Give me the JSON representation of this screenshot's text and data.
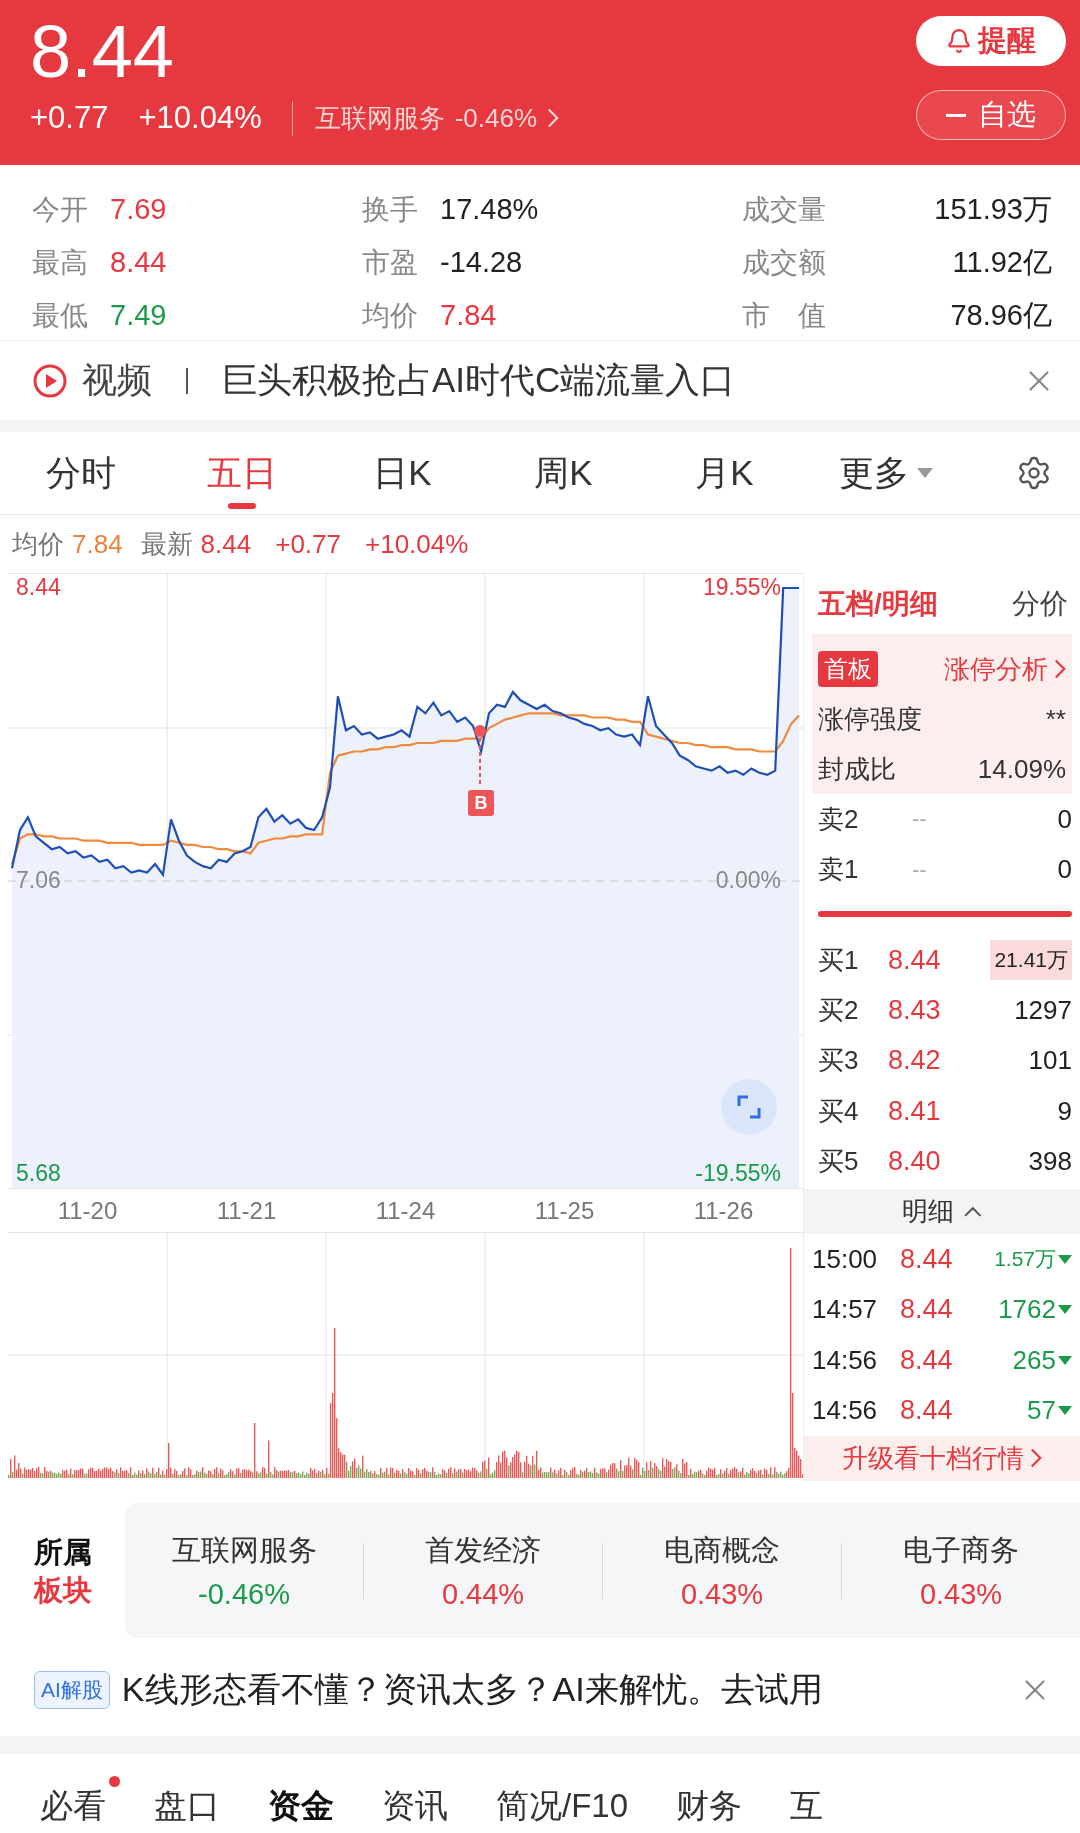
{
  "header": {
    "price": "8.44",
    "change": "+0.77",
    "change_pct": "+10.04%",
    "sector": "互联网服务",
    "sector_change": "-0.46%",
    "alert_button": "提醒",
    "watch_button": "自选"
  },
  "stats": [
    {
      "label": "今开",
      "value": "7.69",
      "color": "#e6393f"
    },
    {
      "label": "换手",
      "value": "17.48%",
      "color": "#222222"
    },
    {
      "label": "成交量",
      "value": "151.93万",
      "color": "#222222"
    },
    {
      "label": "最高",
      "value": "8.44",
      "color": "#e6393f"
    },
    {
      "label": "市盈",
      "value": "-14.28",
      "color": "#222222"
    },
    {
      "label": "成交额",
      "value": "11.92亿",
      "color": "#222222"
    },
    {
      "label": "最低",
      "value": "7.49",
      "color": "#1a9a4a"
    },
    {
      "label": "均价",
      "value": "7.84",
      "color": "#e6393f"
    },
    {
      "label": "市　值",
      "value": "78.96亿",
      "color": "#222222"
    }
  ],
  "news": {
    "tag": "视频",
    "text": "巨头积极抢占AI时代C端流量入口"
  },
  "chart_tabs": [
    {
      "label": "分时",
      "selected": false
    },
    {
      "label": "五日",
      "selected": true
    },
    {
      "label": "日K",
      "selected": false
    },
    {
      "label": "周K",
      "selected": false
    },
    {
      "label": "月K",
      "selected": false
    },
    {
      "label": "更多",
      "selected": false
    }
  ],
  "chart_info": {
    "avg": "7.84",
    "last": "8.44",
    "change": "+0.77",
    "change_pct": "+10.04%"
  },
  "chart": {
    "right_labels": [
      "19.55%",
      "0.00%",
      "-19.55%"
    ],
    "marker": "B",
    "dates": [
      "11-20",
      "11-21",
      "11-24",
      "11-25",
      "11-26"
    ],
    "chart_data": {
      "type": "line",
      "ylim": [
        5.68,
        8.44
      ],
      "yticks": [
        8.44,
        7.06,
        5.68
      ],
      "series": [
        {
          "name": "最新",
          "color": "#1f4fb5",
          "values": [
            7.12,
            7.3,
            7.36,
            7.27,
            7.24,
            7.21,
            7.22,
            7.19,
            7.2,
            7.17,
            7.18,
            7.15,
            7.16,
            7.12,
            7.13,
            7.1,
            7.11,
            7.1,
            7.14,
            7.09,
            7.35,
            7.25,
            7.18,
            7.15,
            7.13,
            7.12,
            7.16,
            7.15,
            7.19,
            7.2,
            7.22,
            7.36,
            7.4,
            7.34,
            7.37,
            7.33,
            7.35,
            7.31,
            7.3,
            7.36,
            7.5,
            7.93,
            7.77,
            7.79,
            7.75,
            7.76,
            7.73,
            7.74,
            7.75,
            7.77,
            7.74,
            7.88,
            7.85,
            7.9,
            7.84,
            7.86,
            7.81,
            7.83,
            7.79,
            7.67,
            7.85,
            7.89,
            7.88,
            7.95,
            7.91,
            7.89,
            7.87,
            7.89,
            7.86,
            7.85,
            7.83,
            7.82,
            7.8,
            7.79,
            7.77,
            7.78,
            7.75,
            7.74,
            7.75,
            7.7,
            7.93,
            7.79,
            7.75,
            7.71,
            7.65,
            7.63,
            7.6,
            7.59,
            7.58,
            7.6,
            7.57,
            7.58,
            7.56,
            7.59,
            7.57,
            7.56,
            7.58,
            8.44,
            8.44,
            8.44
          ]
        },
        {
          "name": "均价",
          "color": "#f08a3c",
          "values": [
            7.14,
            7.26,
            7.28,
            7.28,
            7.27,
            7.27,
            7.26,
            7.26,
            7.26,
            7.25,
            7.25,
            7.25,
            7.24,
            7.24,
            7.24,
            7.24,
            7.23,
            7.23,
            7.23,
            7.23,
            7.25,
            7.24,
            7.23,
            7.23,
            7.22,
            7.22,
            7.21,
            7.21,
            7.2,
            7.2,
            7.19,
            7.24,
            7.25,
            7.26,
            7.26,
            7.27,
            7.27,
            7.28,
            7.28,
            7.28,
            7.57,
            7.65,
            7.66,
            7.67,
            7.67,
            7.68,
            7.68,
            7.69,
            7.69,
            7.7,
            7.7,
            7.71,
            7.71,
            7.71,
            7.72,
            7.72,
            7.72,
            7.73,
            7.73,
            7.73,
            7.78,
            7.8,
            7.82,
            7.83,
            7.84,
            7.85,
            7.85,
            7.85,
            7.85,
            7.84,
            7.84,
            7.84,
            7.84,
            7.83,
            7.83,
            7.83,
            7.82,
            7.82,
            7.81,
            7.81,
            7.75,
            7.74,
            7.73,
            7.72,
            7.71,
            7.71,
            7.7,
            7.7,
            7.69,
            7.69,
            7.69,
            7.68,
            7.68,
            7.68,
            7.67,
            7.67,
            7.67,
            7.72,
            7.8,
            7.84
          ]
        }
      ]
    }
  },
  "order_book": {
    "tabs": [
      {
        "label": "五档/明细",
        "selected": true
      },
      {
        "label": "分价",
        "selected": false
      }
    ],
    "limit_up": {
      "badge": "首板",
      "link": "涨停分析",
      "rows": [
        {
          "label": "涨停强度",
          "value": "**"
        },
        {
          "label": "封成比",
          "value": "14.09%"
        }
      ]
    },
    "asks": [
      {
        "label": "卖2",
        "price": "--",
        "volume": "0",
        "highlight": false
      },
      {
        "label": "卖1",
        "price": "--",
        "volume": "0",
        "highlight": false
      }
    ],
    "bids": [
      {
        "label": "买1",
        "price": "8.44",
        "volume": "21.41万",
        "highlight": true
      },
      {
        "label": "买2",
        "price": "8.43",
        "volume": "1297",
        "highlight": false
      },
      {
        "label": "买3",
        "price": "8.42",
        "volume": "101",
        "highlight": false
      },
      {
        "label": "买4",
        "price": "8.41",
        "volume": "9",
        "highlight": false
      },
      {
        "label": "买5",
        "price": "8.40",
        "volume": "398",
        "highlight": false
      }
    ],
    "detail_header": "明细",
    "trades": [
      {
        "time": "15:00",
        "price": "8.44",
        "volume": "1.57万"
      },
      {
        "time": "14:57",
        "price": "8.44",
        "volume": "1762"
      },
      {
        "time": "14:56",
        "price": "8.44",
        "volume": "265"
      },
      {
        "time": "14:56",
        "price": "8.44",
        "volume": "57"
      }
    ],
    "upgrade": "升级看十档行情"
  },
  "sectors": {
    "label_top": "所属",
    "label_bottom": "板块",
    "items": [
      {
        "name": "互联网服务",
        "change": "-0.46%",
        "color": "#1a9a4a"
      },
      {
        "name": "首发经济",
        "change": "0.44%",
        "color": "#e6393f"
      },
      {
        "name": "电商概念",
        "change": "0.43%",
        "color": "#e6393f"
      },
      {
        "name": "电子商务",
        "change": "0.43%",
        "color": "#e6393f"
      }
    ]
  },
  "ai_banner": {
    "badge": "AI解股",
    "text": "K线形态看不懂？资讯太多？AI来解忧。去试用"
  },
  "bottom_tabs": [
    {
      "label": "必看",
      "selected": false,
      "dot": true
    },
    {
      "label": "盘口",
      "selected": false,
      "dot": false
    },
    {
      "label": "资金",
      "selected": true,
      "dot": false
    },
    {
      "label": "资讯",
      "selected": false,
      "dot": false
    },
    {
      "label": "简况/F10",
      "selected": false,
      "dot": false
    },
    {
      "label": "财务",
      "selected": false,
      "dot": false
    },
    {
      "label": "互",
      "selected": false,
      "dot": false
    }
  ]
}
